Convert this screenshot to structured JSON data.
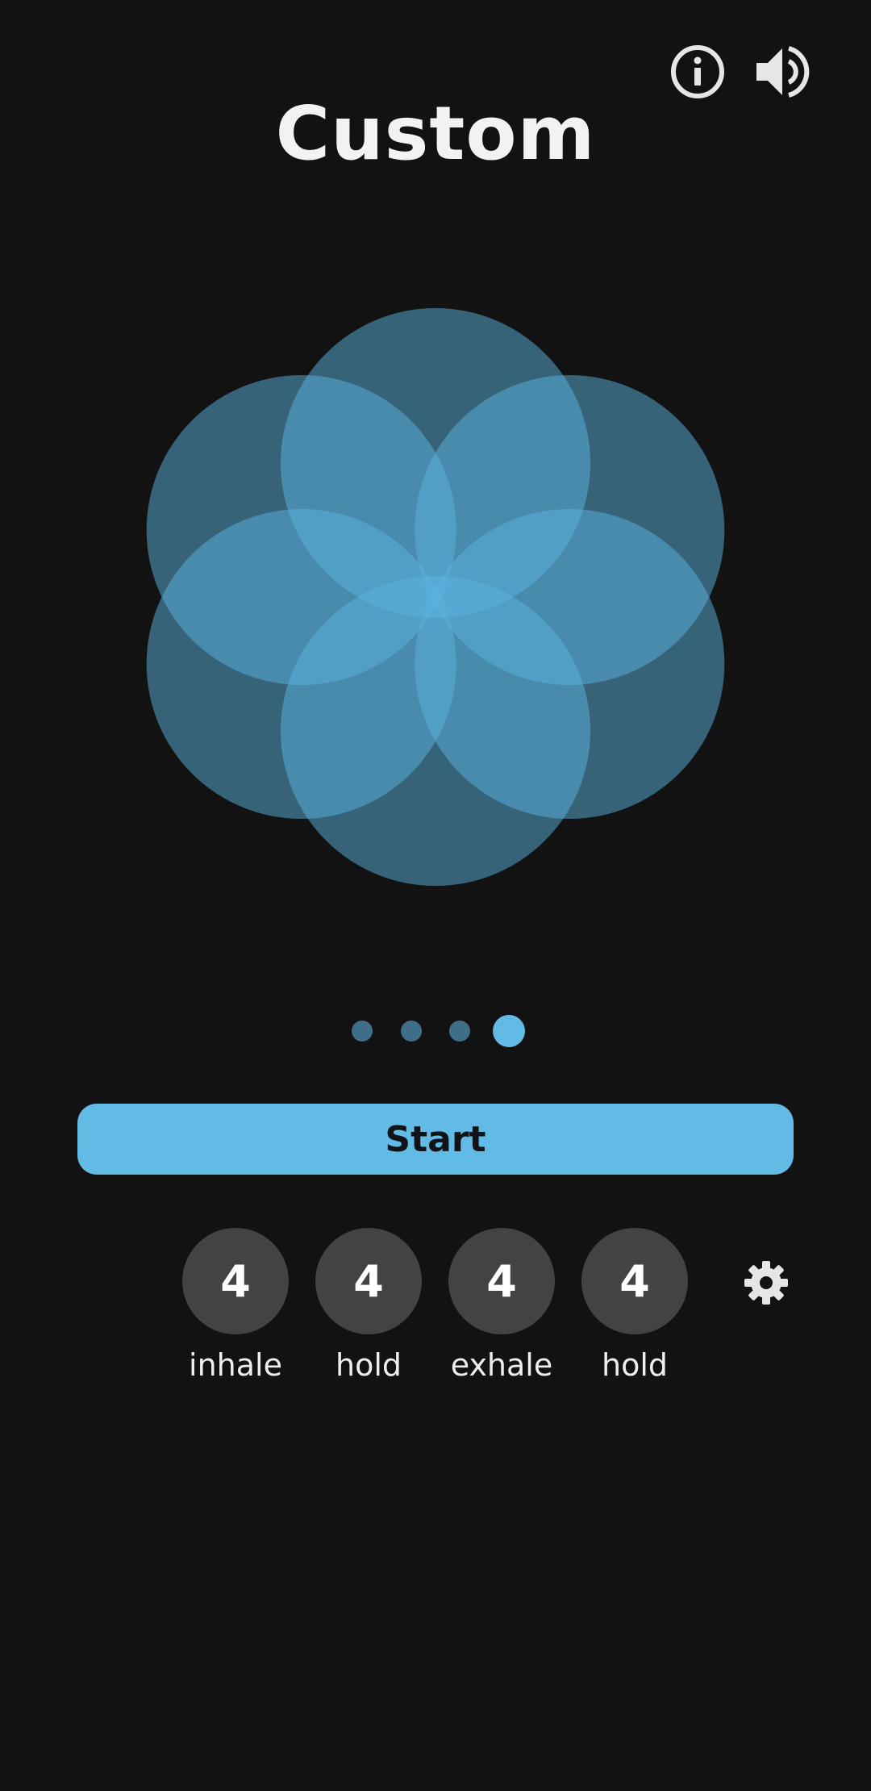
{
  "header": {
    "title": "Custom",
    "info_icon": "info-circle-icon",
    "sound_icon": "volume-icon"
  },
  "colors": {
    "background": "#121212",
    "accent": "#62bbe4",
    "petal": "#5bb4e0",
    "dot_inactive": "#3f6f88",
    "phase_circle": "#434343",
    "text": "#eeeeee"
  },
  "pager": {
    "count": 4,
    "active_index": 3
  },
  "start_button": {
    "label": "Start"
  },
  "phases": [
    {
      "value": "4",
      "label": "inhale"
    },
    {
      "value": "4",
      "label": "hold"
    },
    {
      "value": "4",
      "label": "exhale"
    },
    {
      "value": "4",
      "label": "hold"
    }
  ],
  "settings_icon": "gear-icon"
}
